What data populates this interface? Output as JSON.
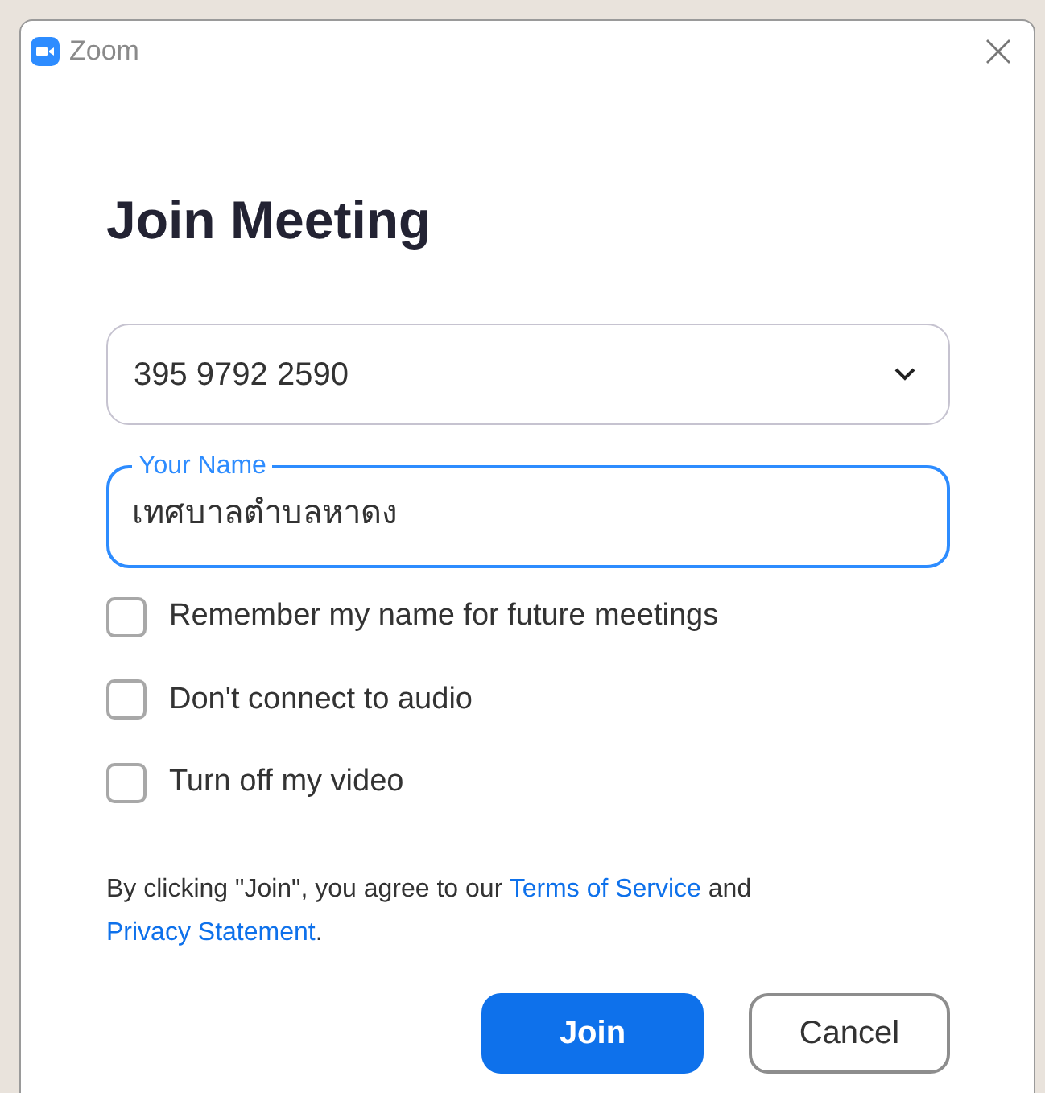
{
  "window": {
    "title": "Zoom"
  },
  "heading": "Join Meeting",
  "meeting_id": {
    "value": "395 9792 2590"
  },
  "name_field": {
    "label": "Your Name",
    "value": "เทศบาลตำบลหาดง",
    "focused": true
  },
  "options": [
    {
      "label": "Remember my name for future meetings",
      "checked": false
    },
    {
      "label": "Don't connect to audio",
      "checked": false
    },
    {
      "label": "Turn off my video",
      "checked": false
    }
  ],
  "agreement": [
    {
      "kind": "text",
      "text": "By clicking \"Join\", you agree to our "
    },
    {
      "kind": "link",
      "text": "Terms of Service"
    },
    {
      "kind": "text",
      "text": " and "
    },
    {
      "kind": "link",
      "text": "Privacy Statement"
    },
    {
      "kind": "text",
      "text": "."
    }
  ],
  "buttons": [
    {
      "label": "Join",
      "kind": "primary"
    },
    {
      "label": "Cancel",
      "kind": "secondary"
    }
  ]
}
